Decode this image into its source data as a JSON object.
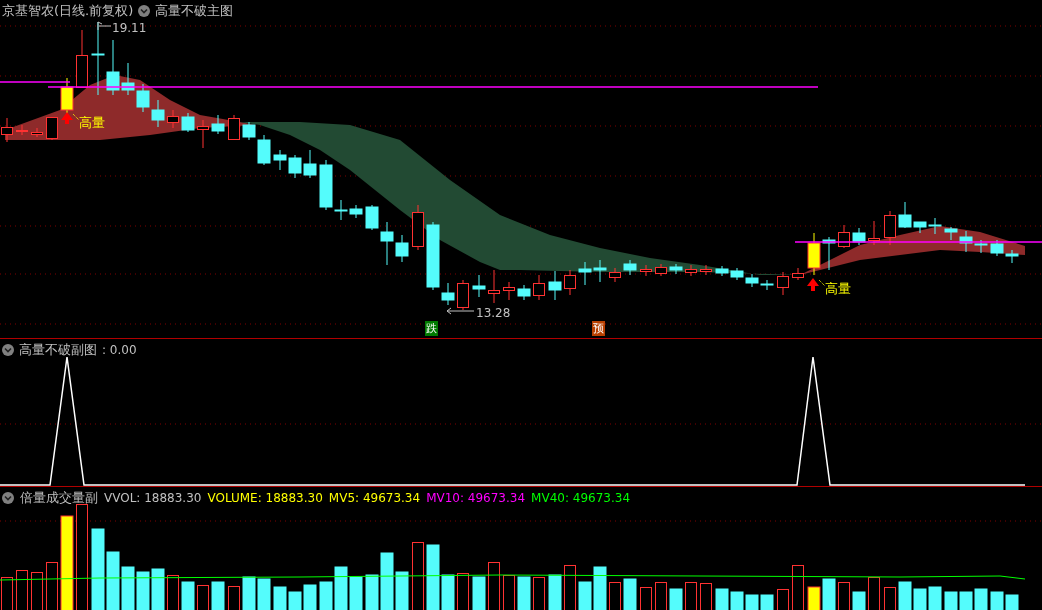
{
  "main_panel": {
    "title": "京基智农(日线.前复权)",
    "indicator": "高量不破主图",
    "high_label": "19.11",
    "low_label": "13.28",
    "signals": [
      {
        "text": "高量"
      },
      {
        "text": "高量"
      }
    ],
    "markers": [
      {
        "text": "跌",
        "color": "#007a00"
      },
      {
        "text": "预",
        "color": "#b84000"
      }
    ]
  },
  "sub_panel": {
    "indicator": "高量不破副图",
    "reading": ": 0.00"
  },
  "volume_panel": {
    "indicator": "倍量成交量副",
    "readings": [
      {
        "text": "VVOL: 18883.30",
        "color": "#c0c0c0"
      },
      {
        "text": "VOLUME: 18883.30",
        "color": "#ffff00"
      },
      {
        "text": "MV5: 49673.34",
        "color": "#ffff00"
      },
      {
        "text": "MV10: 49673.34",
        "color": "#ff00ff"
      },
      {
        "text": "MV40: 49673.34",
        "color": "#00ff00"
      }
    ]
  }
}
